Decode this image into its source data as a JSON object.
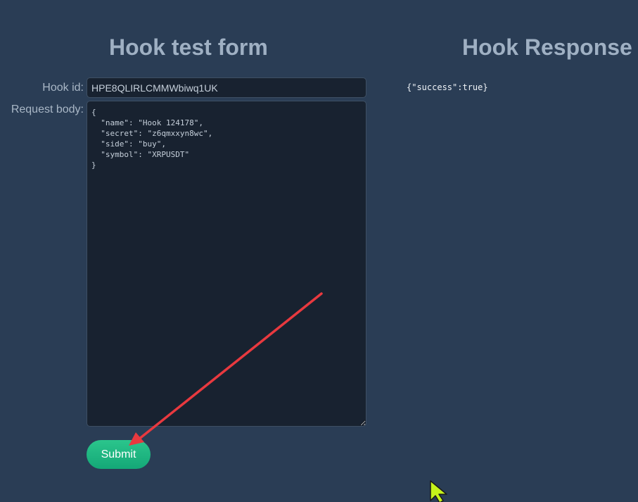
{
  "form": {
    "title": "Hook test form",
    "hook_id_label": "Hook id:",
    "hook_id_value": "HPE8QLIRLCMMWbiwq1UK",
    "request_body_label": "Request body:",
    "request_body_value": "{\n  \"name\": \"Hook 124178\",\n  \"secret\": \"z6qmxxyn8wc\",\n  \"side\": \"buy\",\n  \"symbol\": \"XRPUSDT\"\n}",
    "submit_label": "Submit"
  },
  "response": {
    "title": "Hook Response",
    "body": "{\"success\":true}"
  },
  "colors": {
    "background": "#2a3d55",
    "heading": "#9fb0c3",
    "field_bg": "#182230",
    "submit_green": "#1db882",
    "annotation_arrow": "#e8393f",
    "cursor": "#c6f21a"
  }
}
